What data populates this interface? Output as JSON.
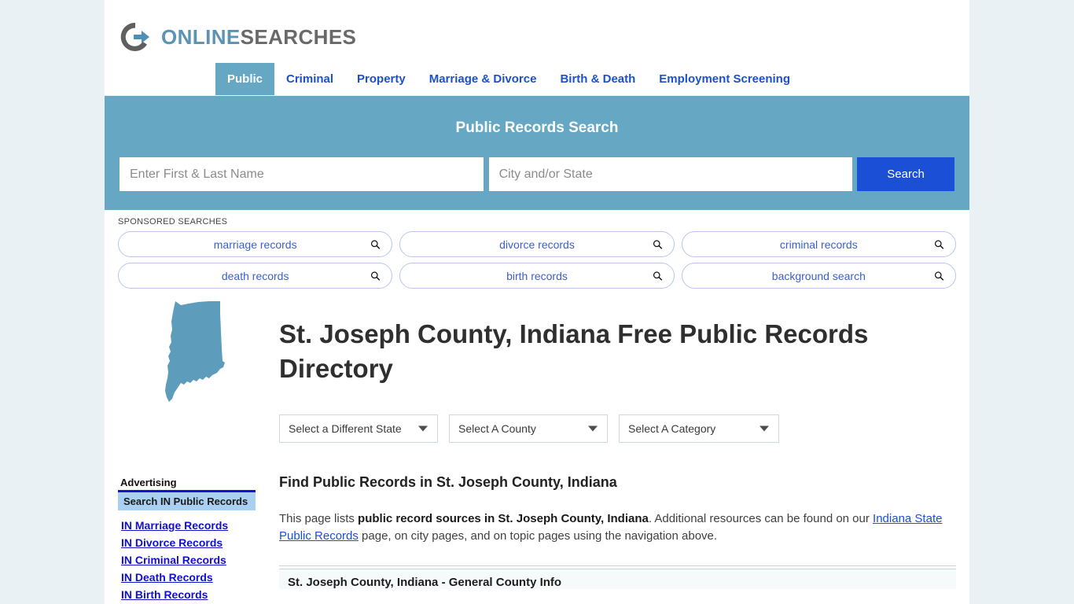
{
  "brand": {
    "name_first": "ONLINE",
    "name_second": "SEARCHES",
    "icon": "circle-arrow-logo-icon",
    "color_first": "#5b93b5",
    "color_second": "#696969"
  },
  "nav": {
    "items": [
      {
        "label": "Public",
        "active": true
      },
      {
        "label": "Criminal",
        "active": false
      },
      {
        "label": "Property",
        "active": false
      },
      {
        "label": "Marriage & Divorce",
        "active": false
      },
      {
        "label": "Birth & Death",
        "active": false
      },
      {
        "label": "Employment Screening",
        "active": false
      }
    ],
    "active_color": "#66a8c4",
    "link_color": "#1c51cc"
  },
  "search_banner": {
    "title": "Public Records Search",
    "name_value": "",
    "name_placeholder": "Enter First & Last Name",
    "city_value": "",
    "city_placeholder": "City and/or State",
    "button_label": "Search",
    "background_color": "#66a8c4",
    "button_color": "#1a4fd6"
  },
  "sponsored": {
    "label": "SPONSORED SEARCHES",
    "items": [
      {
        "label": "marriage records",
        "icon": "search-icon"
      },
      {
        "label": "divorce records",
        "icon": "search-icon"
      },
      {
        "label": "criminal records",
        "icon": "search-icon"
      },
      {
        "label": "death records",
        "icon": "search-icon"
      },
      {
        "label": "birth records",
        "icon": "search-icon"
      },
      {
        "label": "background search",
        "icon": "search-icon"
      }
    ]
  },
  "hero": {
    "state_map_icon": "indiana-state-map-icon",
    "state_map_color": "#5e9cbb",
    "title": "St. Joseph County, Indiana Free Public Records Directory"
  },
  "selectors": [
    {
      "label": "Select a Different State",
      "name": "state-select"
    },
    {
      "label": "Select A County",
      "name": "county-select"
    },
    {
      "label": "Select A Category",
      "name": "category-select"
    }
  ],
  "main": {
    "section_title": "Find Public Records in St. Joseph County, Indiana",
    "intro_prefix": "This page lists ",
    "intro_bold": "public record sources in St. Joseph County, Indiana",
    "intro_middle": ". Additional resources can be found on our ",
    "intro_link": "Indiana State Public Records",
    "intro_suffix": " page, on city pages, and on topic pages using the navigation above.",
    "table_header": "St. Joseph County, Indiana - General County Info"
  },
  "sidebar": {
    "advertising_label": "Advertising",
    "ad_heading": "Search IN Public Records",
    "links": [
      "IN Marriage Records",
      "IN Divorce Records",
      "IN Criminal Records",
      "IN Death Records",
      "IN Birth Records"
    ]
  }
}
